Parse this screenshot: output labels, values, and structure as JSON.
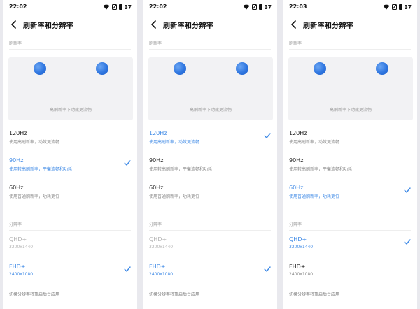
{
  "screens": [
    {
      "time": "22:02",
      "battery": "37",
      "title": "刷新率和分辨率",
      "refresh_section": "刷新率",
      "preview_caption": "高刷新率下动效更流畅",
      "refresh_options": [
        {
          "title": "120Hz",
          "subtitle": "使用高刷新率，动效更流畅",
          "selected": false
        },
        {
          "title": "90Hz",
          "subtitle": "使用较高刷新率，平衡流畅和功耗",
          "selected": true
        },
        {
          "title": "60Hz",
          "subtitle": "使用普通刷新率，功耗更低",
          "selected": false
        }
      ],
      "resolution_section": "分辨率",
      "resolution_options": [
        {
          "title": "QHD+",
          "subtitle": "3200x1440",
          "selected": false,
          "disabled": true
        },
        {
          "title": "FHD+",
          "subtitle": "2400x1080",
          "selected": true,
          "disabled": false
        }
      ],
      "footer_note": "切换分辨率将重启后台应用"
    },
    {
      "time": "22:02",
      "battery": "37",
      "title": "刷新率和分辨率",
      "refresh_section": "刷新率",
      "preview_caption": "高刷新率下动效更流畅",
      "refresh_options": [
        {
          "title": "120Hz",
          "subtitle": "使用高刷新率，动效更流畅",
          "selected": true
        },
        {
          "title": "90Hz",
          "subtitle": "使用较高刷新率，平衡流畅和功耗",
          "selected": false
        },
        {
          "title": "60Hz",
          "subtitle": "使用普通刷新率，功耗更低",
          "selected": false
        }
      ],
      "resolution_section": "分辨率",
      "resolution_options": [
        {
          "title": "QHD+",
          "subtitle": "3200x1440",
          "selected": false,
          "disabled": true
        },
        {
          "title": "FHD+",
          "subtitle": "2400x1080",
          "selected": true,
          "disabled": false
        }
      ],
      "footer_note": "切换分辨率将重启后台应用"
    },
    {
      "time": "22:03",
      "battery": "37",
      "title": "刷新率和分辨率",
      "refresh_section": "刷新率",
      "preview_caption": "高刷新率下动效更流畅",
      "refresh_options": [
        {
          "title": "120Hz",
          "subtitle": "使用高刷新率，动效更流畅",
          "selected": false
        },
        {
          "title": "90Hz",
          "subtitle": "使用较高刷新率，平衡流畅和功耗",
          "selected": false
        },
        {
          "title": "60Hz",
          "subtitle": "使用普通刷新率，功耗更低",
          "selected": true
        }
      ],
      "resolution_section": "分辨率",
      "resolution_options": [
        {
          "title": "QHD+",
          "subtitle": "3200x1440",
          "selected": true,
          "disabled": false
        },
        {
          "title": "FHD+",
          "subtitle": "2400x1080",
          "selected": false,
          "disabled": false
        }
      ],
      "footer_note": "切换分辨率将重启后台应用"
    }
  ],
  "colors": {
    "accent": "#3f8ae6",
    "ball": "#2f76e0",
    "preview_bg": "#f2f2f4",
    "disabled_text": "#b3b3b3"
  },
  "icons": {
    "back": "back-arrow-icon",
    "check": "check-icon",
    "wifi": "wifi-icon",
    "mute": "mute-icon",
    "battery": "battery-icon"
  }
}
